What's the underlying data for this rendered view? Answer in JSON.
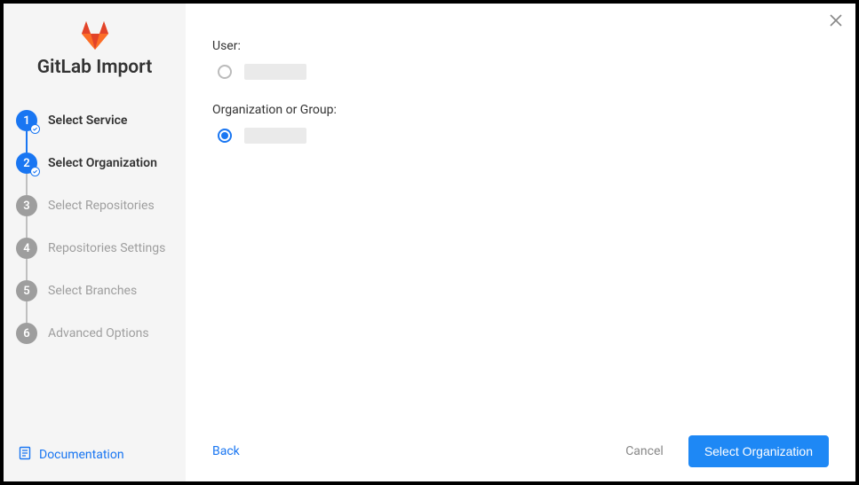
{
  "header": {
    "title": "GitLab Import"
  },
  "steps": [
    {
      "num": "1",
      "label": "Select Service",
      "active": true,
      "checked": true
    },
    {
      "num": "2",
      "label": "Select Organization",
      "active": true,
      "checked": true
    },
    {
      "num": "3",
      "label": "Select Repositories",
      "active": false,
      "checked": false
    },
    {
      "num": "4",
      "label": "Repositories Settings",
      "active": false,
      "checked": false
    },
    {
      "num": "5",
      "label": "Select Branches",
      "active": false,
      "checked": false
    },
    {
      "num": "6",
      "label": "Advanced Options",
      "active": false,
      "checked": false
    }
  ],
  "doc_link": "Documentation",
  "main": {
    "user_label": "User:",
    "org_label": "Organization or Group:"
  },
  "footer": {
    "back": "Back",
    "cancel": "Cancel",
    "next": "Select Organization"
  }
}
